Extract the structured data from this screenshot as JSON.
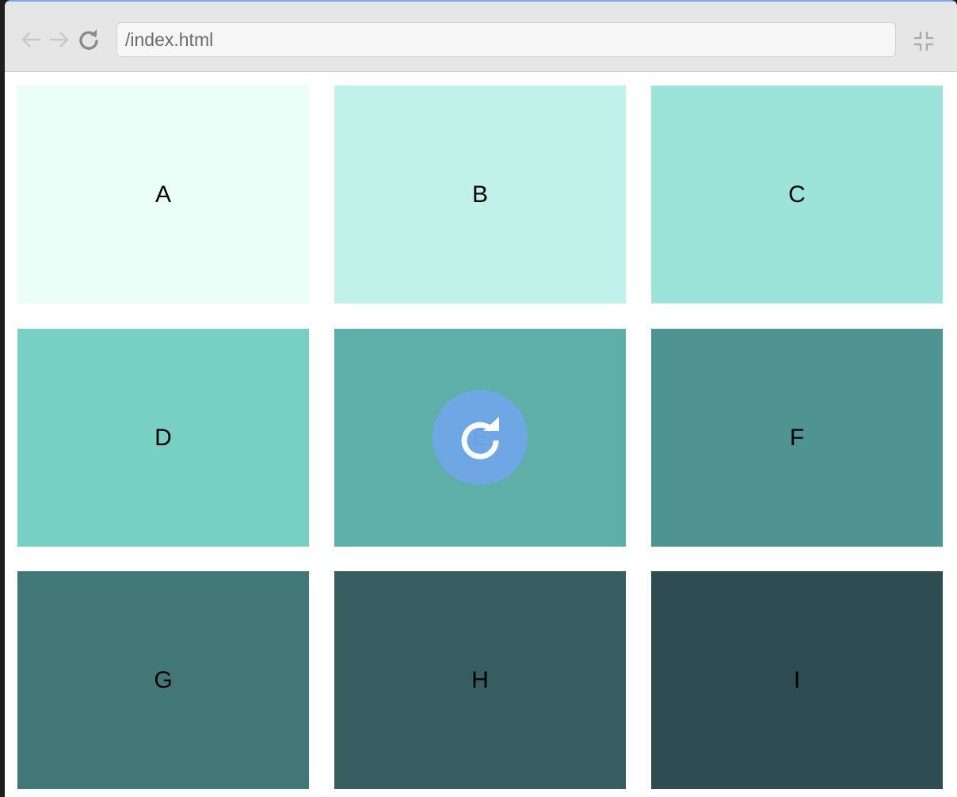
{
  "browser": {
    "address": "/index.html",
    "icons": {
      "back": "arrow-left-icon",
      "forward": "arrow-right-icon",
      "reload": "reload-icon",
      "exit_fullscreen": "exit-fullscreen-icon"
    }
  },
  "tiles": [
    {
      "label": "A",
      "color": "#eafff8"
    },
    {
      "label": "B",
      "color": "#c1f2e9"
    },
    {
      "label": "C",
      "color": "#9ce4d9"
    },
    {
      "label": "D",
      "color": "#78cfc4"
    },
    {
      "label": "E",
      "color": "#5fafa9"
    },
    {
      "label": "F",
      "color": "#509491"
    },
    {
      "label": "G",
      "color": "#417777"
    },
    {
      "label": "H",
      "color": "#365e60"
    },
    {
      "label": "I",
      "color": "#2e4c51"
    }
  ],
  "overlay": {
    "icon": "reload-icon",
    "color": "#70a6e6"
  }
}
